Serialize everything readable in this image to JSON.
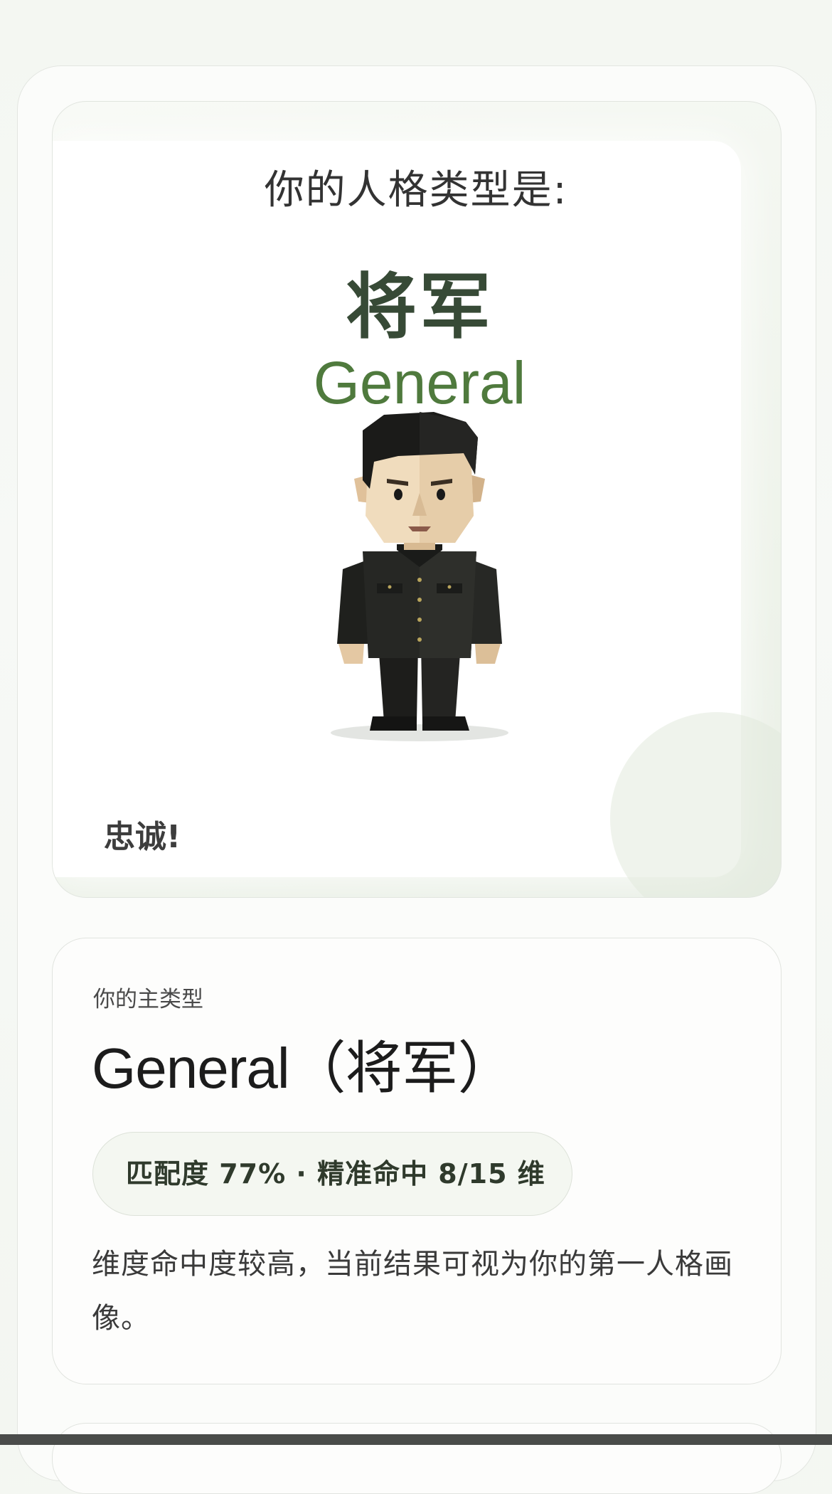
{
  "hero": {
    "heading": "你的人格类型是:",
    "type_cn": "将军",
    "type_en": "General",
    "motto": "忠诚!",
    "figure_icon": "general-character-illustration"
  },
  "result": {
    "label": "你的主类型",
    "title": "General（将军）",
    "match_text": "匹配度 77% · 精准命中 8/15 维",
    "description": "维度命中度较高，当前结果可视为你的第一人格画像。"
  },
  "colors": {
    "accent_green": "#4f7a3d",
    "title_dark_green": "#374a36"
  }
}
